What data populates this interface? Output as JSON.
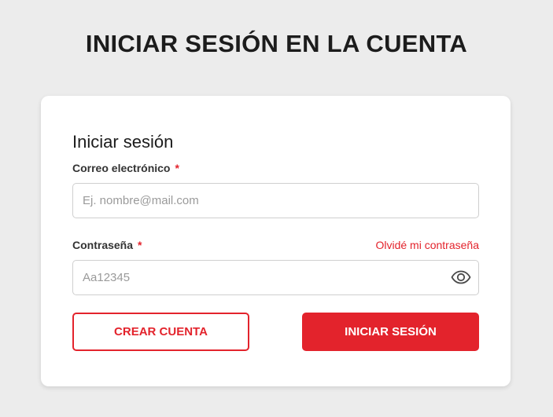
{
  "page": {
    "title": "INICIAR SESIÓN EN LA CUENTA"
  },
  "login_form": {
    "heading": "Iniciar sesión",
    "email": {
      "label": "Correo electrónico",
      "required_mark": "*",
      "placeholder": "Ej. nombre@mail.com",
      "value": ""
    },
    "password": {
      "label": "Contraseña",
      "required_mark": "*",
      "placeholder": "Aa12345",
      "value": "",
      "toggle_icon": "eye-icon"
    },
    "forgot_password_link": "Olvidé mi contraseña",
    "create_account_button": "CREAR CUENTA",
    "login_button": "INICIAR SESIÓN"
  },
  "colors": {
    "accent": "#e3232c",
    "background": "#ececec",
    "card": "#ffffff"
  }
}
